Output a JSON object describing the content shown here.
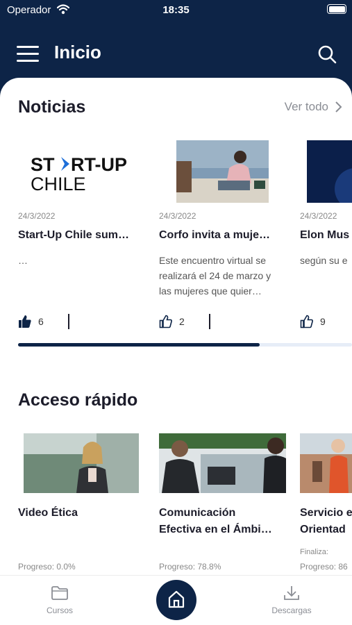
{
  "status_bar": {
    "carrier": "Operador",
    "time": "18:35"
  },
  "header": {
    "title": "Inicio"
  },
  "news": {
    "title": "Noticias",
    "see_all": "Ver todo",
    "items": [
      {
        "date": "24/3/2022",
        "title": "Start-Up Chile sum…",
        "body": "…",
        "likes": "6",
        "logo_text": "START-UP CHILE"
      },
      {
        "date": "24/3/2022",
        "title": "Corfo invita a muje…",
        "body": "Este encuentro virtual se realizará el 24 de marzo y las mujeres que quier…",
        "likes": "2"
      },
      {
        "date": "24/3/2022",
        "title": "Elon Mus",
        "body": "según su e",
        "likes": "9"
      }
    ]
  },
  "quick_access": {
    "title": "Acceso rápido",
    "items": [
      {
        "title_l1": "Video Ética",
        "title_l2": "",
        "progress": "Progreso: 0.0%",
        "ends": ""
      },
      {
        "title_l1": "Comunicación",
        "title_l2": "Efectiva en el Ámbi…",
        "progress": "Progreso: 78.8%",
        "ends": ""
      },
      {
        "title_l1": "Servicio e",
        "title_l2": "Orientad",
        "progress": "Progreso: 86",
        "ends": "Finaliza:"
      }
    ]
  },
  "tab_bar": {
    "courses": "Cursos",
    "downloads": "Descargas"
  },
  "colors": {
    "navy": "#0d2447",
    "text": "#1c1c2a",
    "muted": "#8a8d94"
  }
}
